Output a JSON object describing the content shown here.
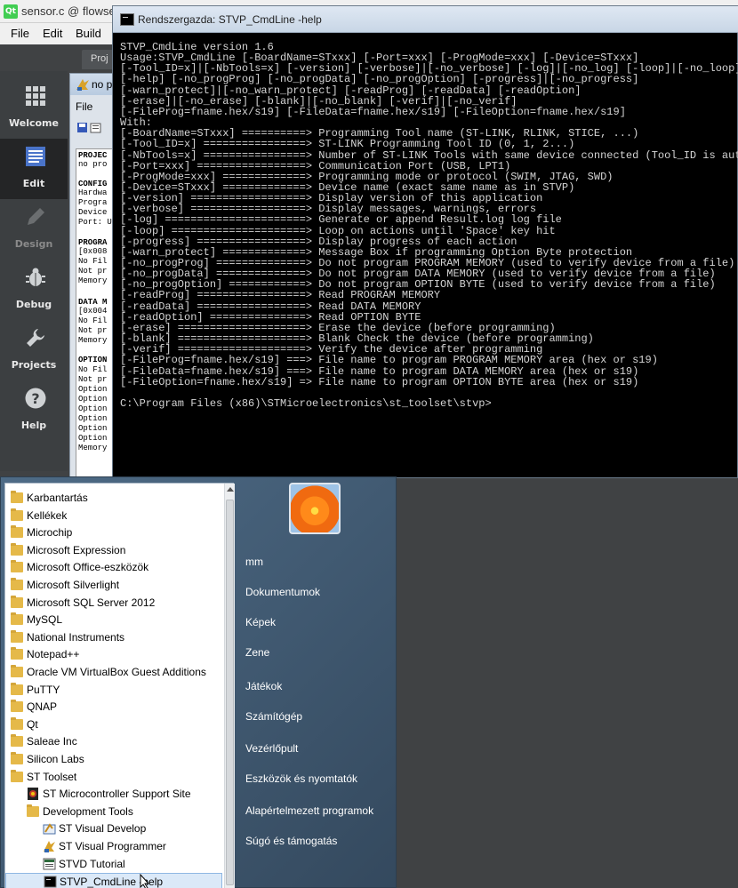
{
  "qt": {
    "title": "sensor.c @ flowsen",
    "menu": [
      "File",
      "Edit",
      "Build"
    ],
    "tab": "Proj",
    "modes": [
      "Welcome",
      "Edit",
      "Design",
      "Debug",
      "Projects",
      "Help"
    ]
  },
  "stvp": {
    "title": "no p",
    "menu": "File",
    "panel": [
      "PROJEC",
      "no pro",
      "CONFIG",
      "Hardwa",
      "Progra",
      "Device",
      "Port: U",
      "PROGRA",
      "[0x008",
      "No Fil",
      "Not pr",
      "Memory",
      "DATA M",
      "[0x004",
      "No Fil",
      "Not pr",
      "Memory",
      "OPTION",
      "No Fil",
      "Not pr",
      "Option",
      "Option",
      "Option",
      "Option",
      "Option",
      "Option",
      "Memory"
    ]
  },
  "console": {
    "title": "Rendszergazda: STVP_CmdLine -help",
    "lines": [
      "STVP_CmdLine version 1.6",
      "Usage:STVP_CmdLine [-BoardName=STxxx] [-Port=xxx] [-ProgMode=xxx] [-Device=STxxx]",
      "[-Tool_ID=x]|[-NbTools=x] [-version] [-verbose]|[-no_verbose] [-log]|[-no_log] [-loop]|[-no_loop]",
      "[-help] [-no_progProg] [-no_progData] [-no_progOption] [-progress]|[-no_progress]",
      "[-warn_protect]|[-no_warn_protect] [-readProg] [-readData] [-readOption]",
      "[-erase]|[-no_erase] [-blank]|[-no_blank] [-verif]|[-no_verif]",
      "[-FileProg=fname.hex/s19] [-FileData=fname.hex/s19] [-FileOption=fname.hex/s19]",
      "With:",
      "[-BoardName=STxxx] ==========> Programming Tool name (ST-LINK, RLINK, STICE, ...)",
      "[-Tool_ID=x] ================> ST-LINK Programming Tool ID (0, 1, 2...)",
      "[-NbTools=x] ================> Number of ST-LINK Tools with same device connected (Tool_ID is automatic",
      "[-Port=xxx] =================> Communication Port (USB, LPT1)",
      "[-ProgMode=xxx] =============> Programming mode or protocol (SWIM, JTAG, SWD)",
      "[-Device=STxxx] =============> Device name (exact same name as in STVP)",
      "[-version] ==================> Display version of this application",
      "[-verbose] ==================> Display messages, warnings, errors",
      "[-log] ======================> Generate or append Result.log log file",
      "[-loop] =====================> Loop on actions until 'Space' key hit",
      "[-progress] =================> Display progress of each action",
      "[-warn_protect] =============> Message Box if programming Option Byte protection",
      "[-no_progProg] ==============> Do not program PROGRAM MEMORY (used to verify device from a file)",
      "[-no_progData] ==============> Do not program DATA MEMORY (used to verify device from a file)",
      "[-no_progOption] ============> Do not program OPTION BYTE (used to verify device from a file)",
      "[-readProg] =================> Read PROGRAM MEMORY",
      "[-readData] =================> Read DATA MEMORY",
      "[-readOption] ===============> Read OPTION BYTE",
      "[-erase] ====================> Erase the device (before programming)",
      "[-blank] ====================> Blank Check the device (before programming)",
      "[-verif] ====================> Verify the device after programming",
      "[-FileProg=fname.hex/s19] ===> File name to program PROGRAM MEMORY area (hex or s19)",
      "[-FileData=fname.hex/s19] ===> File name to program DATA MEMORY area (hex or s19)",
      "[-FileOption=fname.hex/s19] => File name to program OPTION BYTE area (hex or s19)",
      "",
      "C:\\Program Files (x86)\\STMicroelectronics\\st_toolset\\stvp>"
    ]
  },
  "start_menu": {
    "programs": [
      {
        "label": "Karbantartás",
        "type": "folder",
        "indent": 0
      },
      {
        "label": "Kellékek",
        "type": "folder",
        "indent": 0
      },
      {
        "label": "Microchip",
        "type": "folder",
        "indent": 0
      },
      {
        "label": "Microsoft Expression",
        "type": "folder",
        "indent": 0
      },
      {
        "label": "Microsoft Office-eszközök",
        "type": "folder",
        "indent": 0
      },
      {
        "label": "Microsoft Silverlight",
        "type": "folder",
        "indent": 0
      },
      {
        "label": "Microsoft SQL Server 2012",
        "type": "folder",
        "indent": 0
      },
      {
        "label": "MySQL",
        "type": "folder",
        "indent": 0
      },
      {
        "label": "National Instruments",
        "type": "folder",
        "indent": 0
      },
      {
        "label": "Notepad++",
        "type": "folder",
        "indent": 0
      },
      {
        "label": "Oracle VM VirtualBox Guest Additions",
        "type": "folder",
        "indent": 0
      },
      {
        "label": "PuTTY",
        "type": "folder",
        "indent": 0
      },
      {
        "label": "QNAP",
        "type": "folder",
        "indent": 0
      },
      {
        "label": "Qt",
        "type": "folder",
        "indent": 0
      },
      {
        "label": "Saleae Inc",
        "type": "folder",
        "indent": 0
      },
      {
        "label": "Silicon Labs",
        "type": "folder",
        "indent": 0
      },
      {
        "label": "ST Toolset",
        "type": "folder",
        "indent": 0
      },
      {
        "label": "ST Microcontroller Support Site",
        "type": "web",
        "indent": 1
      },
      {
        "label": "Development Tools",
        "type": "folder",
        "indent": 1
      },
      {
        "label": "ST Visual Develop",
        "type": "stvd",
        "indent": 2
      },
      {
        "label": "ST Visual Programmer",
        "type": "stvp",
        "indent": 2
      },
      {
        "label": "STVD Tutorial",
        "type": "tutorial",
        "indent": 2
      },
      {
        "label": "STVP_CmdLine -help",
        "type": "console",
        "indent": 2,
        "selected": true
      }
    ],
    "right_items": [
      "mm",
      "Dokumentumok",
      "Képek",
      "Zene",
      "Játékok",
      "Számítógép",
      "Vezérlőpult",
      "Eszközök és nyomtatók",
      "Alapértelmezett programok",
      "Súgó és támogatás"
    ]
  }
}
